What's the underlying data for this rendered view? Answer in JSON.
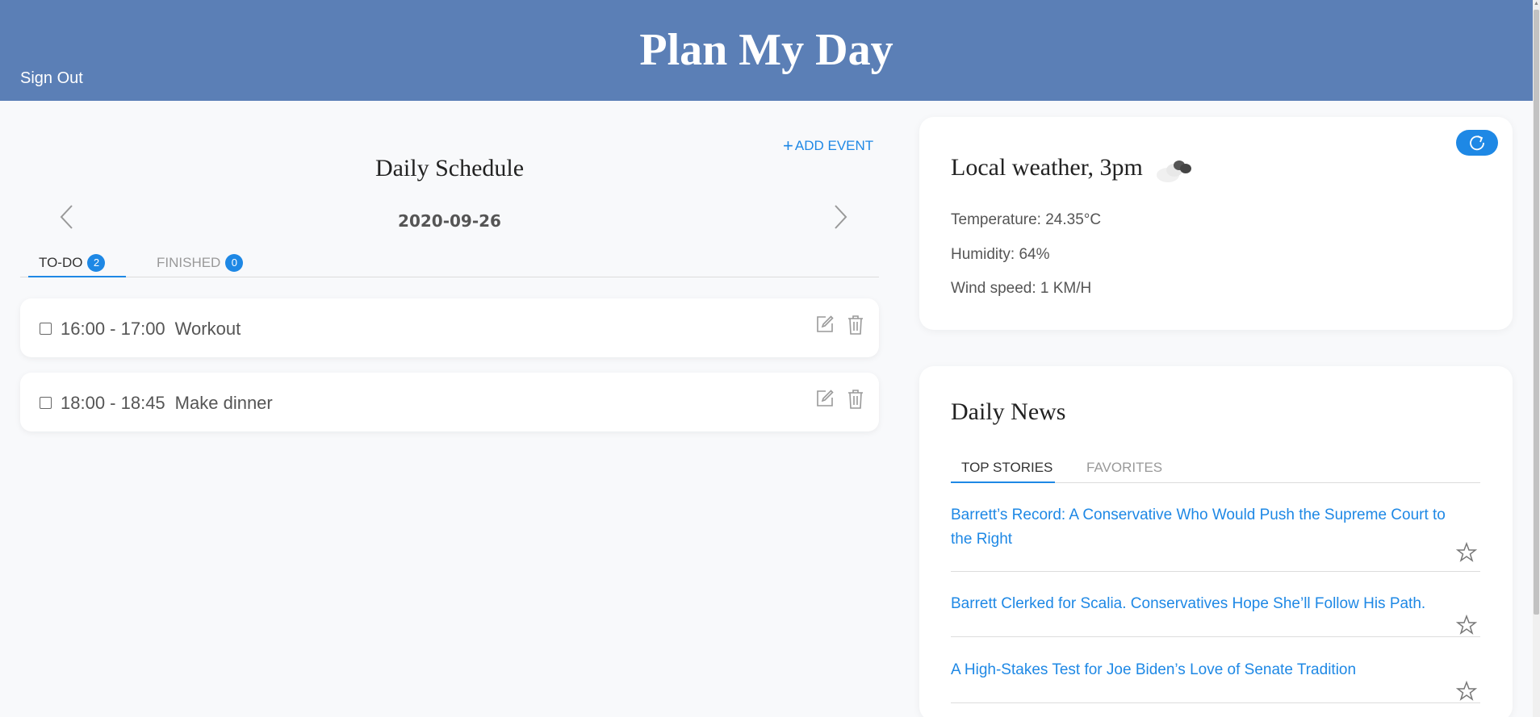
{
  "header": {
    "title": "Plan My Day",
    "sign_out": "Sign Out"
  },
  "schedule": {
    "add_event": "ADD EVENT",
    "title": "Daily Schedule",
    "date": "2020-09-26",
    "tabs": [
      {
        "label": "TO-DO",
        "count": "2"
      },
      {
        "label": "FINISHED",
        "count": "0"
      }
    ],
    "events": [
      {
        "time": "16:00 - 17:00",
        "name": "Workout"
      },
      {
        "time": "18:00 - 18:45",
        "name": "Make dinner"
      }
    ]
  },
  "weather": {
    "title": "Local weather, 3pm",
    "icon": "cloudy-icon",
    "temperature": "Temperature: 24.35°C",
    "humidity": "Humidity: 64%",
    "wind": "Wind speed: 1 KM/H"
  },
  "news": {
    "title": "Daily News",
    "tabs": [
      "TOP STORIES",
      "FAVORITES"
    ],
    "stories": [
      "Barrett’s Record: A Conservative Who Would Push the Supreme Court to the Right",
      "Barrett Clerked for Scalia. Conservatives Hope She’ll Follow His Path.",
      "A High-Stakes Test for Joe Biden’s Love of Senate Tradition"
    ]
  },
  "colors": {
    "header": "#5b7fb6",
    "accent": "#1e88e5",
    "background": "#f8f9fb"
  }
}
